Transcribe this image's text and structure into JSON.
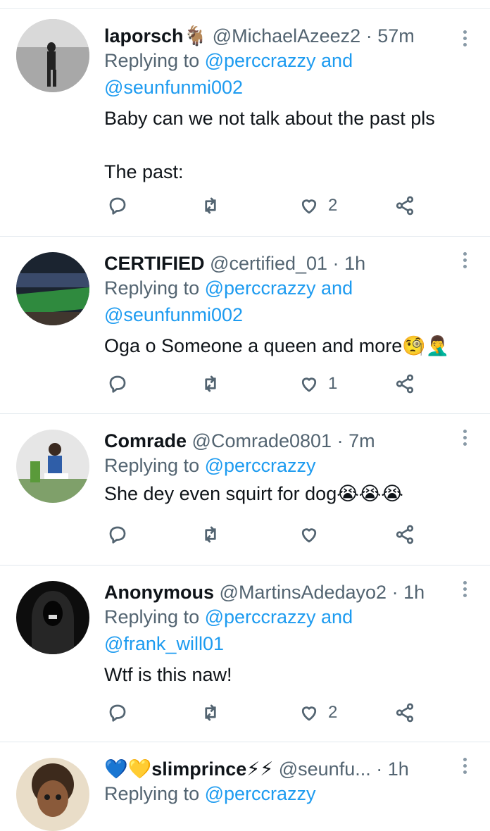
{
  "tweets": [
    {
      "name": "laporsch🐐",
      "handle": "@MichaelAzeez2",
      "sep": "·",
      "time": "57m",
      "reply_prefix": "Replying to ",
      "reply_users": "@perccrazzy and @seunfunmi002",
      "text": "Baby can we not talk about the past pls\n\nThe past:",
      "likes": "2",
      "avatar_color": "#9a9a9a"
    },
    {
      "name": "CERTIFIED",
      "handle": "@certified_01",
      "sep": "·",
      "time": "1h",
      "reply_prefix": "Replying to ",
      "reply_users": "@perccrazzy and @seunfunmi002",
      "text": "Oga o Someone a queen and more🧐🤦‍♂️",
      "likes": "1",
      "avatar_color": "#2f6b3a"
    },
    {
      "name": "Comrade",
      "handle": "@Comrade0801",
      "sep": "·",
      "time": "7m",
      "reply_prefix": "Replying to ",
      "reply_users": "@perccrazzy",
      "text": "She dey even squirt for dog😭😭😭",
      "likes": "",
      "avatar_color": "#cfcfcf"
    },
    {
      "name": "Anonymous",
      "handle": "@MartinsAdedayo2",
      "sep": "·",
      "time": "1h",
      "reply_prefix": "Replying to ",
      "reply_users": "@perccrazzy and @frank_will01",
      "text": "Wtf is this naw!",
      "likes": "2",
      "avatar_color": "#1a1a1a"
    },
    {
      "name": "💙💛slimprince⚡⚡",
      "handle": "@seunfu...",
      "sep": "·",
      "time": "1h",
      "reply_prefix": "Replying to ",
      "reply_users": "@perccrazzy",
      "text": "",
      "likes": "",
      "avatar_color": "#6b4a32"
    }
  ],
  "icons": {
    "reply": "reply-icon",
    "retweet": "retweet-icon",
    "like": "heart-icon",
    "share": "share-icon",
    "more": "more-icon"
  },
  "colors": {
    "link": "#1d9bf0",
    "secondary": "#536471"
  }
}
